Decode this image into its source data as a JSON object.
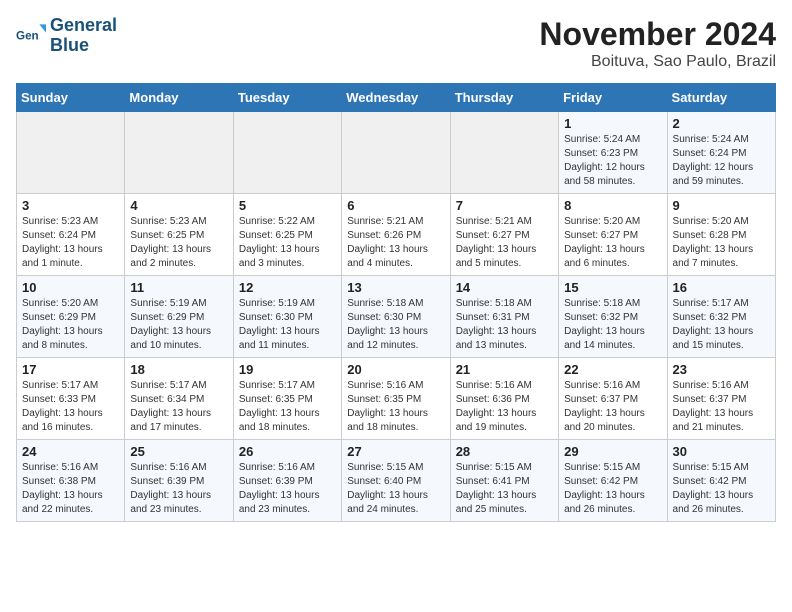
{
  "logo": {
    "line1": "General",
    "line2": "Blue"
  },
  "title": "November 2024",
  "location": "Boituva, Sao Paulo, Brazil",
  "weekdays": [
    "Sunday",
    "Monday",
    "Tuesday",
    "Wednesday",
    "Thursday",
    "Friday",
    "Saturday"
  ],
  "weeks": [
    [
      {
        "day": "",
        "info": ""
      },
      {
        "day": "",
        "info": ""
      },
      {
        "day": "",
        "info": ""
      },
      {
        "day": "",
        "info": ""
      },
      {
        "day": "",
        "info": ""
      },
      {
        "day": "1",
        "info": "Sunrise: 5:24 AM\nSunset: 6:23 PM\nDaylight: 12 hours and 58 minutes."
      },
      {
        "day": "2",
        "info": "Sunrise: 5:24 AM\nSunset: 6:24 PM\nDaylight: 12 hours and 59 minutes."
      }
    ],
    [
      {
        "day": "3",
        "info": "Sunrise: 5:23 AM\nSunset: 6:24 PM\nDaylight: 13 hours and 1 minute."
      },
      {
        "day": "4",
        "info": "Sunrise: 5:23 AM\nSunset: 6:25 PM\nDaylight: 13 hours and 2 minutes."
      },
      {
        "day": "5",
        "info": "Sunrise: 5:22 AM\nSunset: 6:25 PM\nDaylight: 13 hours and 3 minutes."
      },
      {
        "day": "6",
        "info": "Sunrise: 5:21 AM\nSunset: 6:26 PM\nDaylight: 13 hours and 4 minutes."
      },
      {
        "day": "7",
        "info": "Sunrise: 5:21 AM\nSunset: 6:27 PM\nDaylight: 13 hours and 5 minutes."
      },
      {
        "day": "8",
        "info": "Sunrise: 5:20 AM\nSunset: 6:27 PM\nDaylight: 13 hours and 6 minutes."
      },
      {
        "day": "9",
        "info": "Sunrise: 5:20 AM\nSunset: 6:28 PM\nDaylight: 13 hours and 7 minutes."
      }
    ],
    [
      {
        "day": "10",
        "info": "Sunrise: 5:20 AM\nSunset: 6:29 PM\nDaylight: 13 hours and 8 minutes."
      },
      {
        "day": "11",
        "info": "Sunrise: 5:19 AM\nSunset: 6:29 PM\nDaylight: 13 hours and 10 minutes."
      },
      {
        "day": "12",
        "info": "Sunrise: 5:19 AM\nSunset: 6:30 PM\nDaylight: 13 hours and 11 minutes."
      },
      {
        "day": "13",
        "info": "Sunrise: 5:18 AM\nSunset: 6:30 PM\nDaylight: 13 hours and 12 minutes."
      },
      {
        "day": "14",
        "info": "Sunrise: 5:18 AM\nSunset: 6:31 PM\nDaylight: 13 hours and 13 minutes."
      },
      {
        "day": "15",
        "info": "Sunrise: 5:18 AM\nSunset: 6:32 PM\nDaylight: 13 hours and 14 minutes."
      },
      {
        "day": "16",
        "info": "Sunrise: 5:17 AM\nSunset: 6:32 PM\nDaylight: 13 hours and 15 minutes."
      }
    ],
    [
      {
        "day": "17",
        "info": "Sunrise: 5:17 AM\nSunset: 6:33 PM\nDaylight: 13 hours and 16 minutes."
      },
      {
        "day": "18",
        "info": "Sunrise: 5:17 AM\nSunset: 6:34 PM\nDaylight: 13 hours and 17 minutes."
      },
      {
        "day": "19",
        "info": "Sunrise: 5:17 AM\nSunset: 6:35 PM\nDaylight: 13 hours and 18 minutes."
      },
      {
        "day": "20",
        "info": "Sunrise: 5:16 AM\nSunset: 6:35 PM\nDaylight: 13 hours and 18 minutes."
      },
      {
        "day": "21",
        "info": "Sunrise: 5:16 AM\nSunset: 6:36 PM\nDaylight: 13 hours and 19 minutes."
      },
      {
        "day": "22",
        "info": "Sunrise: 5:16 AM\nSunset: 6:37 PM\nDaylight: 13 hours and 20 minutes."
      },
      {
        "day": "23",
        "info": "Sunrise: 5:16 AM\nSunset: 6:37 PM\nDaylight: 13 hours and 21 minutes."
      }
    ],
    [
      {
        "day": "24",
        "info": "Sunrise: 5:16 AM\nSunset: 6:38 PM\nDaylight: 13 hours and 22 minutes."
      },
      {
        "day": "25",
        "info": "Sunrise: 5:16 AM\nSunset: 6:39 PM\nDaylight: 13 hours and 23 minutes."
      },
      {
        "day": "26",
        "info": "Sunrise: 5:16 AM\nSunset: 6:39 PM\nDaylight: 13 hours and 23 minutes."
      },
      {
        "day": "27",
        "info": "Sunrise: 5:15 AM\nSunset: 6:40 PM\nDaylight: 13 hours and 24 minutes."
      },
      {
        "day": "28",
        "info": "Sunrise: 5:15 AM\nSunset: 6:41 PM\nDaylight: 13 hours and 25 minutes."
      },
      {
        "day": "29",
        "info": "Sunrise: 5:15 AM\nSunset: 6:42 PM\nDaylight: 13 hours and 26 minutes."
      },
      {
        "day": "30",
        "info": "Sunrise: 5:15 AM\nSunset: 6:42 PM\nDaylight: 13 hours and 26 minutes."
      }
    ]
  ]
}
